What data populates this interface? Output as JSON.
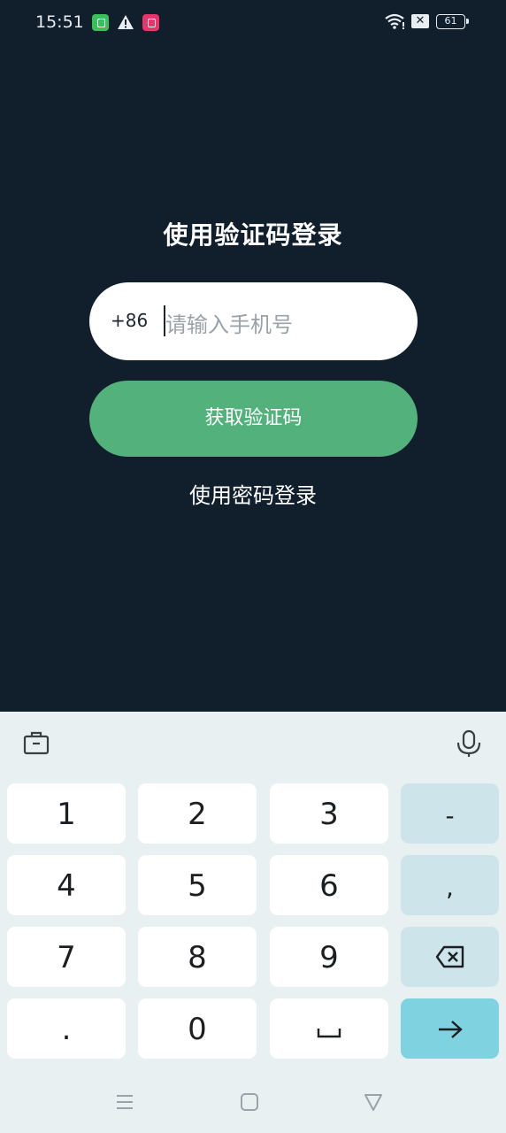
{
  "status_bar": {
    "time": "15:51",
    "battery": "61"
  },
  "login": {
    "title": "使用验证码登录",
    "country_code": "+86",
    "phone_placeholder": "请输入手机号",
    "get_code_label": "获取验证码",
    "password_login_label": "使用密码登录"
  },
  "keyboard": {
    "keys": {
      "k1": "1",
      "k2": "2",
      "k3": "3",
      "minus": "-",
      "k4": "4",
      "k5": "5",
      "k6": "6",
      "comma": ",",
      "k7": "7",
      "k8": "8",
      "k9": "9",
      "dot": ".",
      "k0": "0"
    }
  },
  "colors": {
    "background": "#111f2d",
    "accent_green": "#53b17c",
    "keyboard_bg": "#e9f0f2",
    "enter_key": "#7fd2e0"
  },
  "icons": [
    "wifi-icon",
    "no-sim-icon",
    "battery-icon",
    "toolbox-icon",
    "microphone-icon",
    "backspace-icon",
    "space-icon",
    "enter-arrow-icon",
    "menu-nav-icon",
    "home-nav-icon",
    "back-nav-icon"
  ]
}
